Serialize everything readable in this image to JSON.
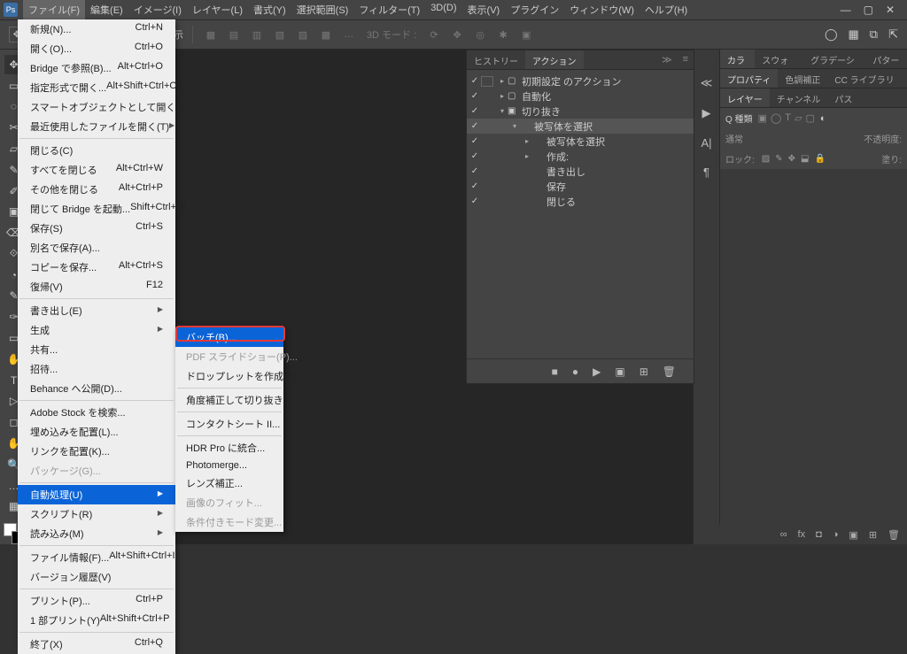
{
  "menubar": {
    "items": [
      "ファイル(F)",
      "編集(E)",
      "イメージ(I)",
      "レイヤー(L)",
      "書式(Y)",
      "選択範囲(S)",
      "フィルター(T)",
      "3D(D)",
      "表示(V)",
      "プラグイン",
      "ウィンドウ(W)",
      "ヘルプ(H)"
    ],
    "active_index": 0
  },
  "window_controls": {
    "min": "—",
    "max": "▢",
    "close": "✕"
  },
  "optbar": {
    "tool_icon": "✥",
    "bb_label": "バウンディングボックスを表示",
    "bb_checked": "✓",
    "align_icons": [
      "▦",
      "▤",
      "▥",
      "▧",
      "▨",
      "▩",
      "…"
    ],
    "mode_label": "3D モード :",
    "mode_icons": [
      "⟳",
      "✥",
      "◎",
      "✱",
      "▣"
    ],
    "right_icons": [
      "◯",
      "▦",
      "⧉",
      "⇱"
    ]
  },
  "left_tools": [
    "✥",
    "▭",
    "◌",
    "✂",
    "▱",
    "✎",
    "✐",
    "▣",
    "⌫",
    "⟐",
    "◔",
    "✎",
    "✑",
    "▭",
    "✋",
    "T",
    "▷",
    "◻",
    "✋",
    "🔍",
    "…",
    "▦"
  ],
  "right_dock_icons": [
    "≪",
    "▶",
    "A|",
    "¶"
  ],
  "panels": {
    "row1": {
      "tabs": [
        "カラー",
        "スウォッチ",
        "グラデーション",
        "パターン"
      ],
      "active": 0
    },
    "row2": {
      "tabs": [
        "プロパティ",
        "色調補正",
        "CC ライブラリ"
      ],
      "active": 0
    },
    "row3": {
      "tabs": [
        "レイヤー",
        "チャンネル",
        "パス"
      ],
      "active": 0
    },
    "layer_search": {
      "kind": "Q 種類",
      "icons": [
        "▣",
        "◯",
        "T",
        "▱",
        "▢"
      ],
      "toggle": "◐"
    },
    "blend_row": {
      "mode": "通常",
      "opacity_label": "不透明度:",
      "opacity": ""
    },
    "lock_row": {
      "label": "ロック:",
      "icons": [
        "▨",
        "✎",
        "✥",
        "⬓",
        "🔒"
      ],
      "fill_label": "塗り:",
      "fill": ""
    }
  },
  "statusbar": {
    "icons": [
      "∞",
      "fx",
      "◘",
      "◑",
      "▣",
      "⊞",
      "🗑"
    ]
  },
  "actions_panel": {
    "tabs": [
      "ヒストリー",
      "アクション"
    ],
    "active_tab": 1,
    "collapse": "≫",
    "menu": "≡",
    "tree": [
      {
        "chk": "✓",
        "box": true,
        "caret": "▸",
        "folder": "▢",
        "label": "初期設定 のアクション",
        "indent": 0
      },
      {
        "chk": "✓",
        "box": false,
        "caret": "▸",
        "folder": "▢",
        "label": "自動化",
        "indent": 0
      },
      {
        "chk": "✓",
        "box": false,
        "caret": "▾",
        "folder": "▣",
        "label": "切り抜き",
        "indent": 0,
        "sel": false
      },
      {
        "chk": "✓",
        "box": false,
        "caret": "▾",
        "folder": "",
        "label": "被写体を選択",
        "indent": 1,
        "sel": true
      },
      {
        "chk": "✓",
        "box": false,
        "caret": "▸",
        "folder": "",
        "label": "被写体を選択",
        "indent": 2
      },
      {
        "chk": "✓",
        "box": false,
        "caret": "▸",
        "folder": "",
        "label": "作成:",
        "indent": 2
      },
      {
        "chk": "✓",
        "box": false,
        "caret": "",
        "folder": "",
        "label": "書き出し",
        "indent": 2
      },
      {
        "chk": "✓",
        "box": false,
        "caret": "",
        "folder": "",
        "label": "保存",
        "indent": 2
      },
      {
        "chk": "✓",
        "box": false,
        "caret": "",
        "folder": "",
        "label": "閉じる",
        "indent": 2
      }
    ],
    "footer_icons": [
      "■",
      "●",
      "▶",
      "▣",
      "⊞",
      "🗑"
    ]
  },
  "file_menu": [
    {
      "t": "item",
      "label": "新規(N)...",
      "sc": "Ctrl+N"
    },
    {
      "t": "item",
      "label": "開く(O)...",
      "sc": "Ctrl+O"
    },
    {
      "t": "item",
      "label": "Bridge で参照(B)...",
      "sc": "Alt+Ctrl+O"
    },
    {
      "t": "item",
      "label": "指定形式で開く...",
      "sc": "Alt+Shift+Ctrl+O"
    },
    {
      "t": "item",
      "label": "スマートオブジェクトとして開く..."
    },
    {
      "t": "sub",
      "label": "最近使用したファイルを開く(T)"
    },
    {
      "t": "sep"
    },
    {
      "t": "item",
      "label": "閉じる(C)"
    },
    {
      "t": "item",
      "label": "すべてを閉じる",
      "sc": "Alt+Ctrl+W"
    },
    {
      "t": "item",
      "label": "その他を閉じる",
      "sc": "Alt+Ctrl+P"
    },
    {
      "t": "item",
      "label": "閉じて Bridge を起動...",
      "sc": "Shift+Ctrl+W"
    },
    {
      "t": "item",
      "label": "保存(S)",
      "sc": "Ctrl+S"
    },
    {
      "t": "item",
      "label": "別名で保存(A)..."
    },
    {
      "t": "item",
      "label": "コピーを保存...",
      "sc": "Alt+Ctrl+S"
    },
    {
      "t": "item",
      "label": "復帰(V)",
      "sc": "F12"
    },
    {
      "t": "sep"
    },
    {
      "t": "sub",
      "label": "書き出し(E)"
    },
    {
      "t": "sub",
      "label": "生成"
    },
    {
      "t": "item",
      "label": "共有..."
    },
    {
      "t": "item",
      "label": "招待..."
    },
    {
      "t": "item",
      "label": "Behance へ公開(D)..."
    },
    {
      "t": "sep"
    },
    {
      "t": "item",
      "label": "Adobe Stock を検索..."
    },
    {
      "t": "item",
      "label": "埋め込みを配置(L)..."
    },
    {
      "t": "item",
      "label": "リンクを配置(K)..."
    },
    {
      "t": "item",
      "label": "パッケージ(G)...",
      "disabled": true
    },
    {
      "t": "sep"
    },
    {
      "t": "sub",
      "label": "自動処理(U)",
      "hl": true
    },
    {
      "t": "sub",
      "label": "スクリプト(R)"
    },
    {
      "t": "sub",
      "label": "読み込み(M)"
    },
    {
      "t": "sep"
    },
    {
      "t": "item",
      "label": "ファイル情報(F)...",
      "sc": "Alt+Shift+Ctrl+I"
    },
    {
      "t": "item",
      "label": "バージョン履歴(V)"
    },
    {
      "t": "sep"
    },
    {
      "t": "item",
      "label": "プリント(P)...",
      "sc": "Ctrl+P"
    },
    {
      "t": "item",
      "label": "1 部プリント(Y)",
      "sc": "Alt+Shift+Ctrl+P"
    },
    {
      "t": "sep"
    },
    {
      "t": "item",
      "label": "終了(X)",
      "sc": "Ctrl+Q"
    }
  ],
  "auto_submenu": [
    {
      "t": "item",
      "label": "バッチ(B)...",
      "hl": true
    },
    {
      "t": "item",
      "label": "PDF スライドショー(P)...",
      "disabled": true
    },
    {
      "t": "item",
      "label": "ドロップレットを作成(C)..."
    },
    {
      "t": "sep"
    },
    {
      "t": "item",
      "label": "角度補正して切り抜き"
    },
    {
      "t": "sep"
    },
    {
      "t": "item",
      "label": "コンタクトシート II..."
    },
    {
      "t": "sep"
    },
    {
      "t": "item",
      "label": "HDR Pro に統合..."
    },
    {
      "t": "item",
      "label": "Photomerge..."
    },
    {
      "t": "item",
      "label": "レンズ補正..."
    },
    {
      "t": "item",
      "label": "画像のフィット...",
      "disabled": true
    },
    {
      "t": "item",
      "label": "条件付きモード変更...",
      "disabled": true
    }
  ]
}
